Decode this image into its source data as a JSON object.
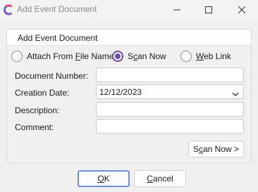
{
  "window": {
    "title": "Add Event Document",
    "app_icon": "app-logo-icon",
    "controls": [
      "minimize-icon",
      "maximize-icon",
      "close-icon"
    ]
  },
  "group": {
    "title": "Add Event Document"
  },
  "source": {
    "options": [
      {
        "label_pre": "Attach From ",
        "label_u": "F",
        "label_post": "ile Name",
        "checked": false
      },
      {
        "label_pre": "S",
        "label_u": "c",
        "label_post": "an Now",
        "checked": true
      },
      {
        "label_pre": "",
        "label_u": "W",
        "label_post": "eb Link",
        "checked": false
      }
    ]
  },
  "form": {
    "document_number": {
      "label": "Document Number:",
      "value": ""
    },
    "creation_date": {
      "label": "Creation Date:",
      "value": "12/12/2023"
    },
    "description": {
      "label": "Description:",
      "value": ""
    },
    "comment": {
      "label": "Comment:",
      "value": ""
    }
  },
  "buttons": {
    "scan_pre": "S",
    "scan_u": "c",
    "scan_post": "an Now >",
    "ok_u": "O",
    "ok_post": "K",
    "cancel_u": "C",
    "cancel_post": "ancel"
  },
  "colors": {
    "accent": "#6a4ca8",
    "focus_border": "#6e8fd0"
  }
}
